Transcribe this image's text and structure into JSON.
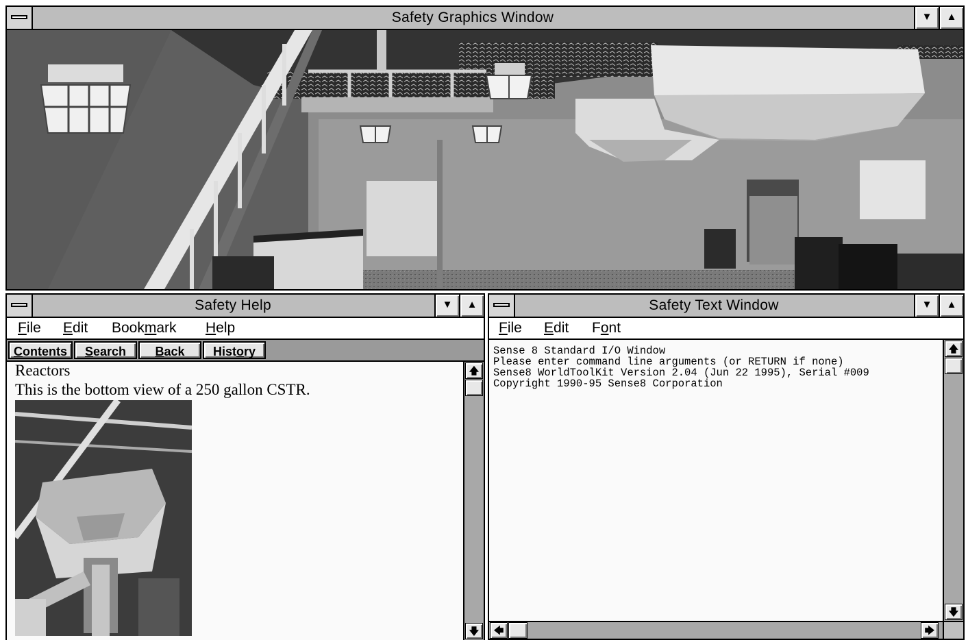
{
  "graphics_window": {
    "title": "Safety Graphics Window",
    "minimize_glyph": "▼",
    "maximize_glyph": "▲"
  },
  "help_window": {
    "title": "Safety Help",
    "minimize_glyph": "▼",
    "maximize_glyph": "▲",
    "menu": {
      "file_u": "F",
      "file_rest": "ile",
      "edit_u": "E",
      "edit_rest": "dit",
      "bookmark_pre": "Book",
      "bookmark_u": "m",
      "bookmark_rest": "ark",
      "help_u": "H",
      "help_rest": "elp"
    },
    "buttons": {
      "contents_u": "C",
      "contents_rest": "ontents",
      "search_u": "S",
      "search_rest": "earch",
      "back_u": "B",
      "back_rest": "ack",
      "history_pre": "Hist",
      "history_u": "o",
      "history_rest": "ry"
    },
    "topic_heading": "Reactors",
    "topic_text": "This is the bottom view of a 250 gallon CSTR.",
    "scroll_up": "🡅",
    "scroll_down": "🡇"
  },
  "text_window": {
    "title": "Safety Text Window",
    "minimize_glyph": "▼",
    "maximize_glyph": "▲",
    "menu": {
      "file_u": "F",
      "file_rest": "ile",
      "edit_u": "E",
      "edit_rest": "dit",
      "font_pre": "F",
      "font_u": "o",
      "font_rest": "nt"
    },
    "lines": [
      "Sense 8 Standard I/O Window",
      "Please enter command line arguments (or RETURN if none)",
      "Sense8 WorldToolKit Version 2.04 (Jun 22 1995), Serial #009",
      "Copyright 1990-95 Sense8 Corporation"
    ],
    "scroll_up": "🡅",
    "scroll_down": "🡇",
    "scroll_left": "🡄",
    "scroll_right": "🡆"
  },
  "icons": [
    "system-menu-icon",
    "minimize-icon",
    "maximize-icon",
    "scroll-up-icon",
    "scroll-down-icon",
    "scroll-left-icon",
    "scroll-right-icon"
  ]
}
